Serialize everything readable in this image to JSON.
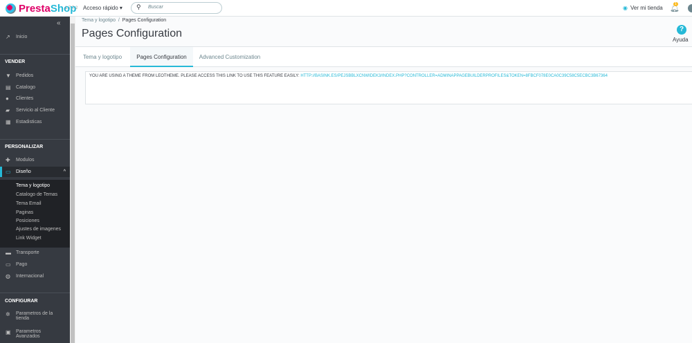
{
  "header": {
    "brand_a": "Presta",
    "brand_b": "Shop",
    "version": "1.7.7.2",
    "quick_access": "Acceso rápido ▾",
    "search_placeholder": "Buscar",
    "view_store": "Ver mi tienda",
    "notifications": "1"
  },
  "sidebar": {
    "inicio": "Inicio",
    "sections": [
      "VENDER",
      "PERSONALIZAR",
      "CONFIGURAR"
    ],
    "vender": [
      "Pedidos",
      "Catalogo",
      "Clientes",
      "Servicio al Cliente",
      "Estadisticas"
    ],
    "personalizar": [
      "Modulos",
      "Diseño"
    ],
    "diseno_sub": [
      "Tema y logotipo",
      "Catalogo de Temas",
      "Tema Email",
      "Paginas",
      "Posiciones",
      "Ajustes de imagenes",
      "Link Widget"
    ],
    "more": [
      "Transporte",
      "Pago",
      "Internacional"
    ],
    "configurar": [
      "Parametros de la tienda",
      "Parametros Avanzados"
    ]
  },
  "breadcrumb": {
    "parent": "Tema y logotipo",
    "current": "Pages Configuration"
  },
  "page_title": "Pages Configuration",
  "help_label": "Ayuda",
  "tabs": [
    "Tema y logotipo",
    "Pages Configuration",
    "Advanced Customization"
  ],
  "notice": {
    "text": "YOU ARE USING A THEME FROM LEOTHEME. PLEASE ACCESS THIS LINK TO USE THIS FEATURE EASILY:",
    "link": "HTTP://BASINK.ES/PEJSBBLXCNWIDEK3/INDEX.PHP?CONTROLLER=ADMINAPPAGEBUILDERPROFILES&TOKEN=8FBCF078E0CA0C39C58C5ECBC3B67364"
  },
  "colors": {
    "accent": "#25b9d7",
    "sidebar": "#363a41",
    "brand": "#df0067"
  }
}
